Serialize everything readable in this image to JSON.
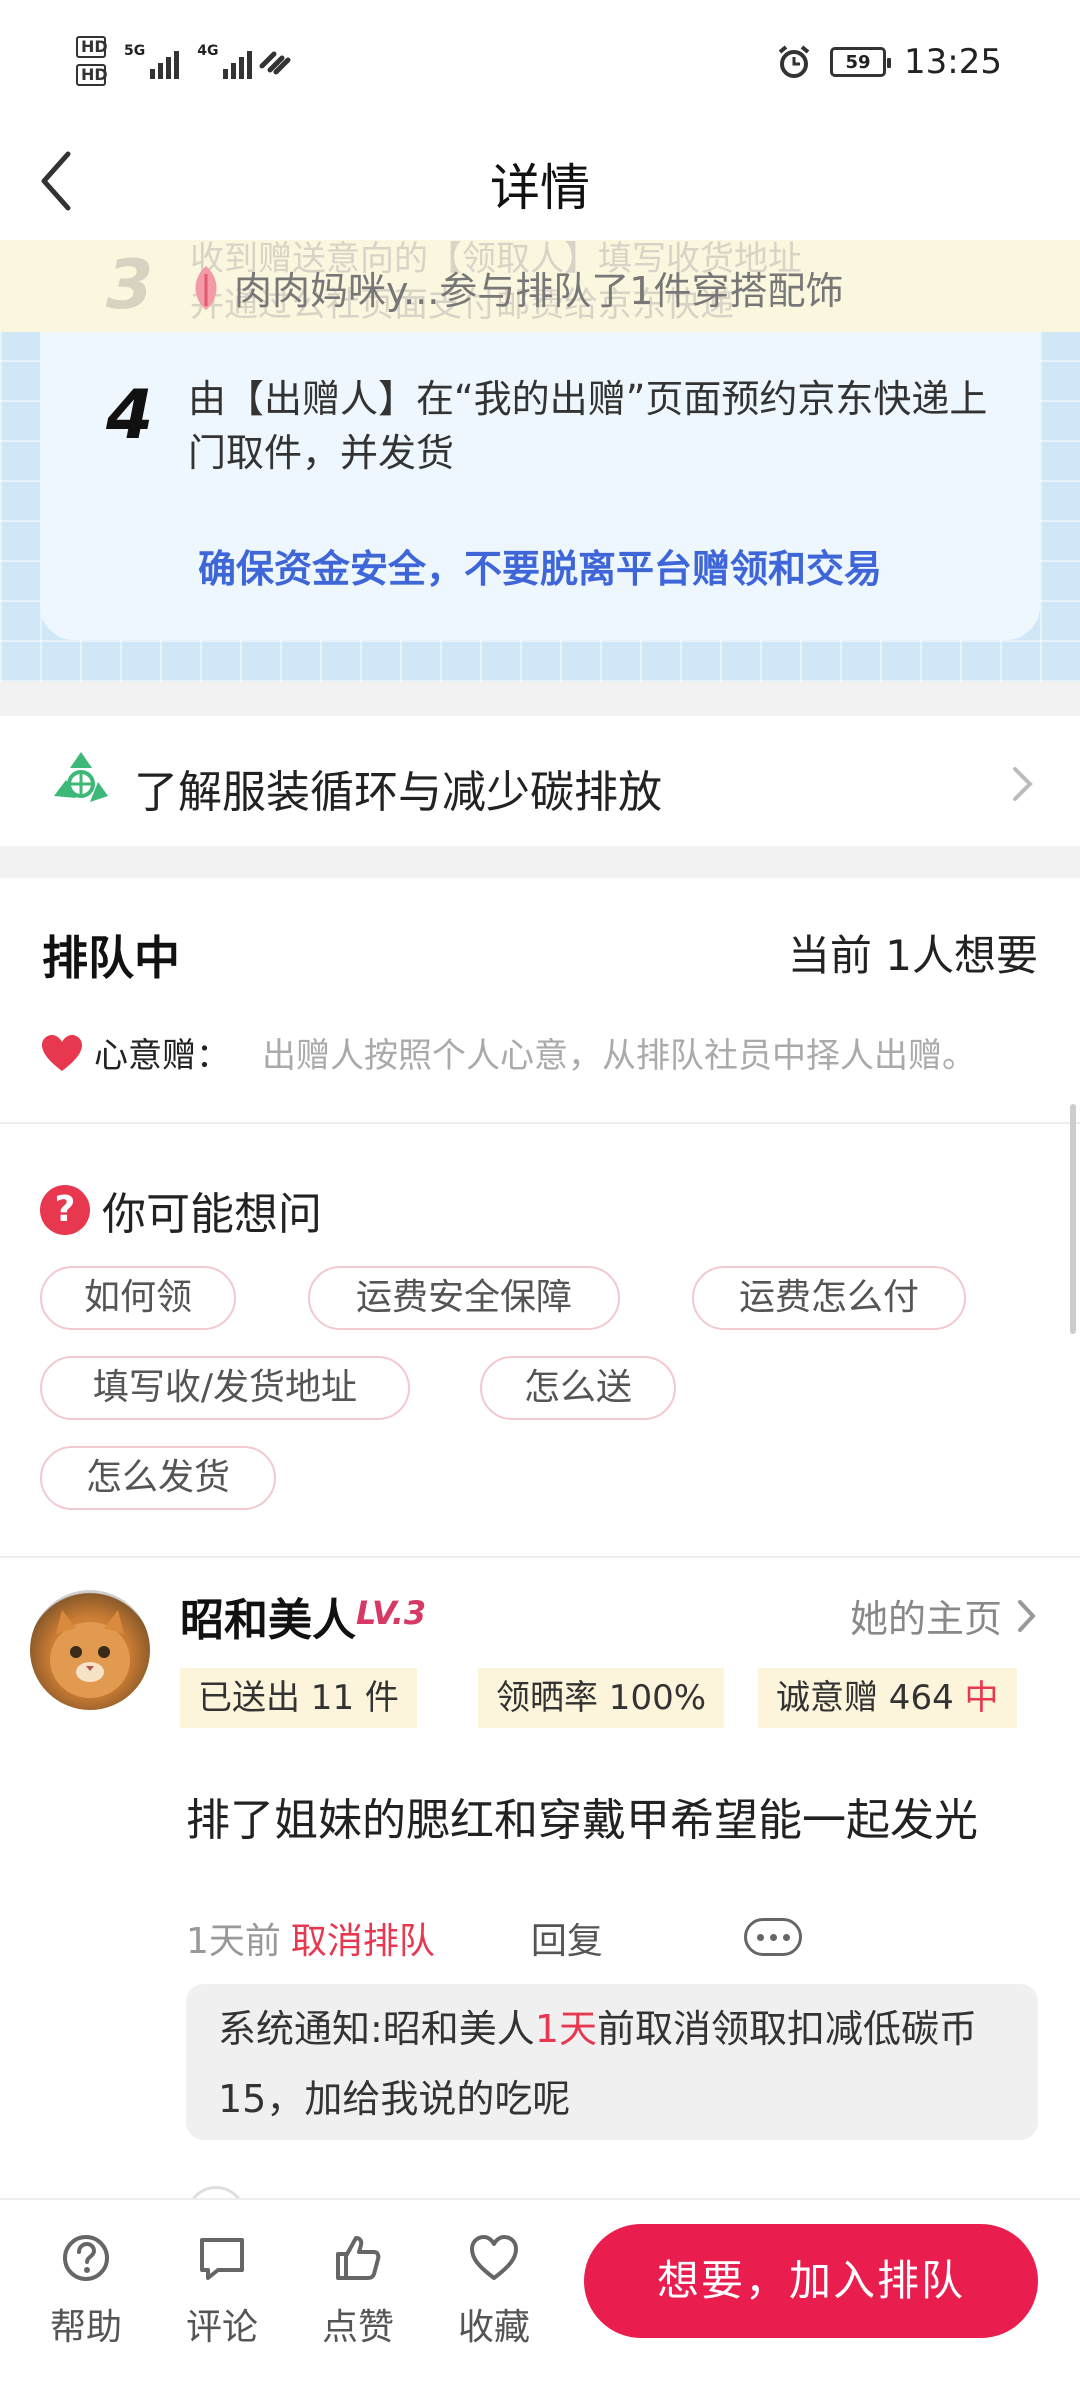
{
  "status_bar": {
    "hd1": "HD",
    "hd2": "HD",
    "net1": "5G",
    "net2": "4G",
    "battery": "59",
    "time": "13:25"
  },
  "nav": {
    "title": "详情"
  },
  "steps": {
    "step3_num": "3",
    "step3_text_line1": "收到赠送意向的【领取人】填写收货地址",
    "step3_text_line2": "并通过公社页面支付邮费给京东快递",
    "toast": "肉肉妈咪y...参与排队了1件穿搭配饰",
    "step4_num": "4",
    "step4_text": "由【出赠人】在“我的出赠”页面预约京东快递上门取件，并发货",
    "warning": "确保资金安全，不要脱离平台赠领和交易"
  },
  "carbon": {
    "label": "了解服装循环与减少碳排放"
  },
  "queue": {
    "title": "排队中",
    "count": "当前 1人想要",
    "mode_label": "心意赠：",
    "mode_desc": "出赠人按照个人心意，从排队社员中择人出赠。"
  },
  "faq": {
    "title": "你可能想问",
    "chips": [
      "如何领",
      "运费安全保障",
      "运费怎么付",
      "填写收/发货地址",
      "怎么送",
      "怎么发货"
    ]
  },
  "comment": {
    "user_name": "昭和美人",
    "level": "LV.3",
    "homepage": "她的主页",
    "stat_sent": "已送出 11 件",
    "stat_rate": "领晒率 100%",
    "stat_sincere": "诚意赠 464",
    "stat_sincere_tag": "中",
    "text": "排了姐妹的腮红和穿戴甲希望能一起发光",
    "time": "1天前",
    "cancel": "取消排队",
    "reply": "回复",
    "notice_prefix": "系统通知:昭和美人",
    "notice_highlight": "1天",
    "notice_suffix": "前取消领取扣减低碳币15，加给我说的吃呢"
  },
  "bottom": {
    "help": "帮助",
    "comment": "评论",
    "like": "点赞",
    "favorite": "收藏",
    "cta": "想要，加入排队"
  },
  "colors": {
    "accent": "#e91e4f",
    "warning_blue": "#3f66d8",
    "steps_bg": "#cfe7f7"
  }
}
